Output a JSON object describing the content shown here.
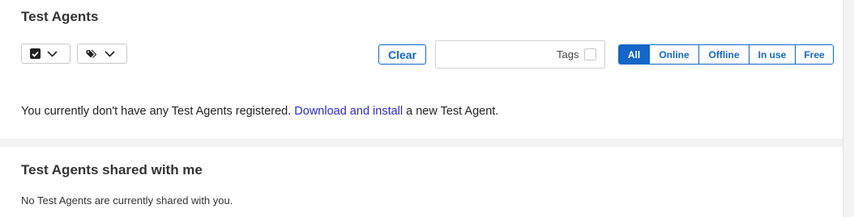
{
  "page": {
    "title": "Test Agents",
    "shared_title": "Test Agents shared with me",
    "shared_message": "No Test Agents are currently shared with you."
  },
  "toolbar": {
    "select_dropdown_icon": "checkbox-checked-icon",
    "tags_dropdown_icon": "tag-icon",
    "clear_label": "Clear",
    "tags_filter": {
      "value": "",
      "placeholder": "",
      "label": "Tags",
      "checked": false
    },
    "status_filters": [
      {
        "label": "All",
        "active": true
      },
      {
        "label": "Online",
        "active": false
      },
      {
        "label": "Offline",
        "active": false
      },
      {
        "label": "In use",
        "active": false
      },
      {
        "label": "Free",
        "active": false
      }
    ]
  },
  "empty_state": {
    "prefix": "You currently don't have any Test Agents registered. ",
    "link": "Download and install",
    "suffix": " a new Test Agent."
  },
  "colors": {
    "accent": "#1466c8",
    "link": "#2a2ad0",
    "background": "#f3f3f3",
    "panel": "#ffffff"
  }
}
